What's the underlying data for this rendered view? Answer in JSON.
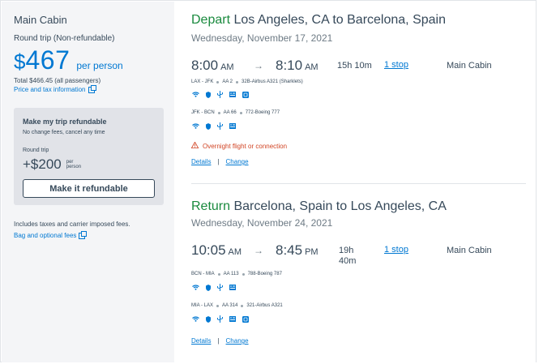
{
  "summary": {
    "cabin": "Main Cabin",
    "trip_type": "Round trip (Non-refundable)",
    "price_currency": "$",
    "price_amount": "467",
    "per_person": "per person",
    "total": "Total $466.45 (all passengers)",
    "price_info_link": "Price and tax information",
    "refund": {
      "title": "Make my trip refundable",
      "subtitle": "No change fees, cancel any time",
      "round_trip": "Round trip",
      "price": "+$200",
      "per": "per",
      "person": "person",
      "button": "Make it refundable"
    },
    "fees_note": "Includes taxes and carrier imposed fees.",
    "bag_link": "Bag and optional fees"
  },
  "depart": {
    "direction": "Depart",
    "route": "Los Angeles, CA to Barcelona, Spain",
    "date": "Wednesday, November 17, 2021",
    "dep_time": "8:00",
    "dep_ampm": "AM",
    "arr_time": "8:10",
    "arr_ampm": "AM",
    "duration_1": "15h 10m",
    "stops": "1 stop",
    "cabin": "Main Cabin",
    "legs": [
      {
        "route": "LAX - JFK",
        "flight": "AA 2",
        "aircraft": "32B-Airbus A321 (Sharklets)"
      },
      {
        "route": "JFK - BCN",
        "flight": "AA 66",
        "aircraft": "772-Boeing 777"
      }
    ],
    "warning": "Overnight flight or connection",
    "details_link": "Details",
    "separator": "|",
    "change_link": "Change"
  },
  "return": {
    "direction": "Return",
    "route": "Barcelona, Spain to Los Angeles, CA",
    "date": "Wednesday, November 24, 2021",
    "dep_time": "10:05",
    "dep_ampm": "AM",
    "arr_time": "8:45",
    "arr_ampm": "PM",
    "duration_1": "19h",
    "duration_2": "40m",
    "stops": "1 stop",
    "cabin": "Main Cabin",
    "legs": [
      {
        "route": "BCN - MIA",
        "flight": "AA 113",
        "aircraft": "788-Boeing 787"
      },
      {
        "route": "MIA - LAX",
        "flight": "AA 314",
        "aircraft": "321-Airbus A321"
      }
    ],
    "details_link": "Details",
    "separator": "|",
    "change_link": "Change"
  },
  "arrow": "→",
  "colors": {
    "link": "#0078d2",
    "green": "#1a8a3e",
    "warning": "#d14424",
    "text": "#36495a"
  },
  "icons": [
    "wifi-icon",
    "shield-icon",
    "usb-power-icon",
    "entertainment-icon",
    "streaming-icon"
  ]
}
